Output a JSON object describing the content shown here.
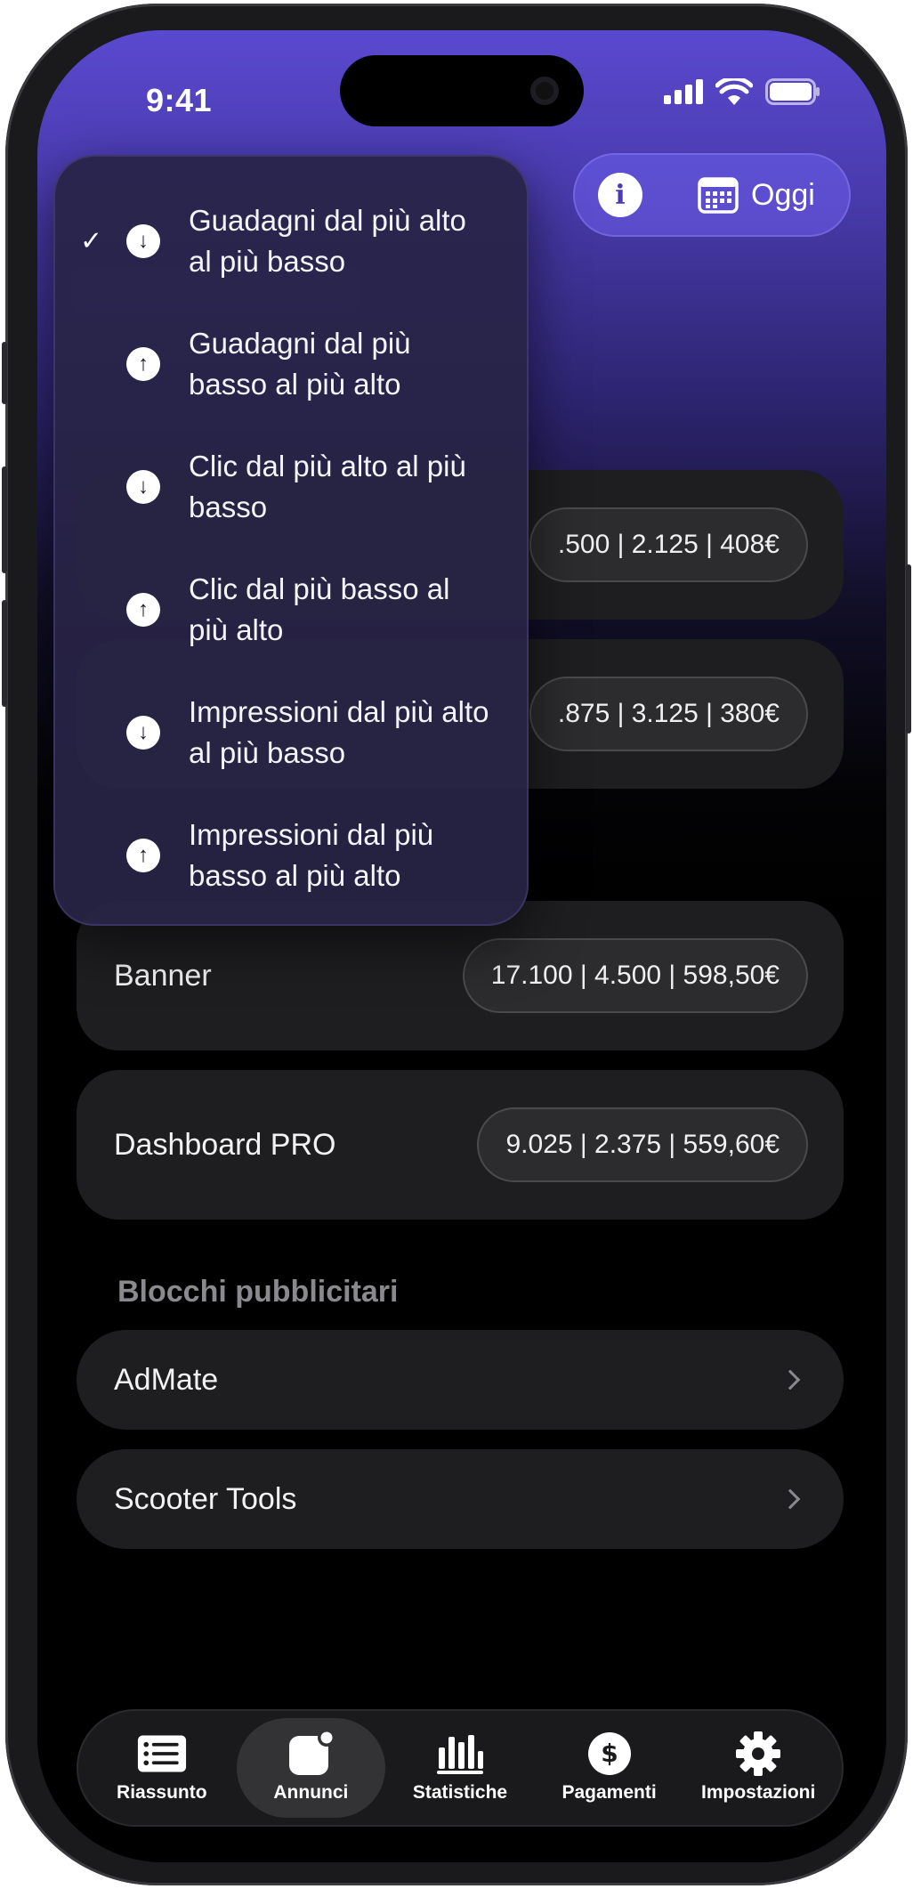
{
  "status_bar": {
    "time": "9:41"
  },
  "header": {
    "date_label": "Oggi"
  },
  "sort_menu": {
    "items": [
      {
        "label": "Guadagni dal più alto al più basso",
        "direction": "down",
        "selected": true
      },
      {
        "label": "Guadagni dal più basso al più alto",
        "direction": "up",
        "selected": false
      },
      {
        "label": "Clic dal più alto al più basso",
        "direction": "down",
        "selected": false
      },
      {
        "label": "Clic dal più basso al più alto",
        "direction": "up",
        "selected": false
      },
      {
        "label": "Impressioni dal più alto al più basso",
        "direction": "down",
        "selected": false
      },
      {
        "label": "Impressioni dal più basso al più alto",
        "direction": "up",
        "selected": false
      }
    ],
    "check_glyph": "✓"
  },
  "formats": [
    {
      "label": "",
      "stats": ".500 | 2.125 | 408€"
    },
    {
      "label": "",
      "stats": ".875 | 3.125 | 380€"
    },
    {
      "label": "Banner",
      "stats": "17.100 | 4.500 | 598,50€"
    },
    {
      "label": "Dashboard PRO",
      "stats": "9.025 | 2.375 | 559,60€"
    }
  ],
  "ad_blocks": {
    "section_title": "Blocchi pubblicitari",
    "items": [
      {
        "label": "AdMate"
      },
      {
        "label": "Scooter Tools"
      }
    ]
  },
  "tabbar": {
    "tabs": [
      {
        "label": "Riassunto",
        "icon": "list-icon",
        "active": false
      },
      {
        "label": "Annunci",
        "icon": "ad-badge-icon",
        "active": true
      },
      {
        "label": "Statistiche",
        "icon": "bar-chart-icon",
        "active": false
      },
      {
        "label": "Pagamenti",
        "icon": "dollar-icon",
        "active": false
      },
      {
        "label": "Impostazioni",
        "icon": "gear-icon",
        "active": false
      }
    ]
  },
  "colors": {
    "accent": "#5a49cf",
    "background": "#000000",
    "card": "#1e1e20"
  }
}
